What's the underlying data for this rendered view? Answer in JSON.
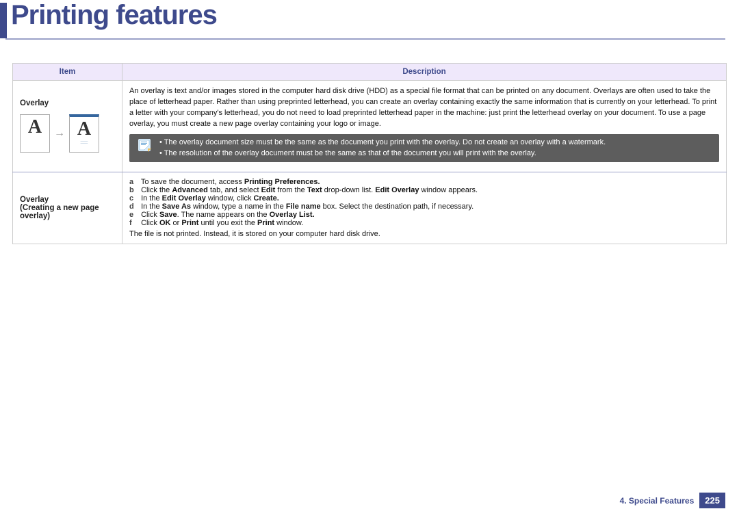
{
  "header": {
    "title": "Printing features"
  },
  "table": {
    "headers": {
      "item": "Item",
      "description": "Description"
    },
    "rows": {
      "overlay": {
        "item_label": "Overlay",
        "desc_text": "An overlay is text and/or images stored in the computer hard disk drive (HDD) as a special file format that can be printed on any document. Overlays are often used to take the place of letterhead paper. Rather than using preprinted letterhead, you can create an overlay containing exactly the same information that is currently on your letterhead. To print a letter with your company's letterhead, you do not need to load preprinted letterhead paper in the machine: just print the letterhead overlay on your document.\nTo use a page overlay, you must create a new page overlay containing your logo or image.",
        "note_bullets": [
          "• The overlay document size must be the same as the document you print with the overlay. Do not create an overlay with a watermark.",
          "• The resolution of the overlay document must be the same as that of the document you will print with the overlay."
        ],
        "graphic": {
          "letter": "A"
        }
      },
      "overlay_create": {
        "item_label": "Overlay",
        "item_sub": "(Creating a new page overlay)",
        "steps": [
          {
            "k": "a",
            "pre": "To save the document, access ",
            "b1": "Printing Preferences.",
            "post": ""
          },
          {
            "k": "b",
            "pre": "Click the ",
            "b1": "Advanced",
            "mid1": " tab, and select ",
            "b2": "Edit",
            "mid2": " from the ",
            "b3": "Text",
            "mid3": " drop-down list. ",
            "b4": "Edit Overlay",
            "post": " window appears."
          },
          {
            "k": "c",
            "pre": "In the ",
            "b1": "Edit Overlay",
            "mid1": " window, click ",
            "b2": "Create.",
            "post": ""
          },
          {
            "k": "d",
            "pre": "In the ",
            "b1": "Save As",
            "mid1": " window, type a name in the ",
            "b2": "File name",
            "post": " box. Select the destination path, if necessary."
          },
          {
            "k": "e",
            "pre": "Click ",
            "b1": "Save",
            "mid1": ". The name appears on the ",
            "b2": "Overlay List.",
            "post": ""
          },
          {
            "k": "f",
            "pre": "Click ",
            "b1": "OK",
            "mid1": " or ",
            "b2": "Print",
            "mid2": " until you exit the ",
            "b3": "Print",
            "post": " window."
          }
        ],
        "tail": "The file is not printed. Instead, it is stored on your computer hard disk drive."
      }
    }
  },
  "footer": {
    "section": "4.  Special Features",
    "page": "225"
  }
}
